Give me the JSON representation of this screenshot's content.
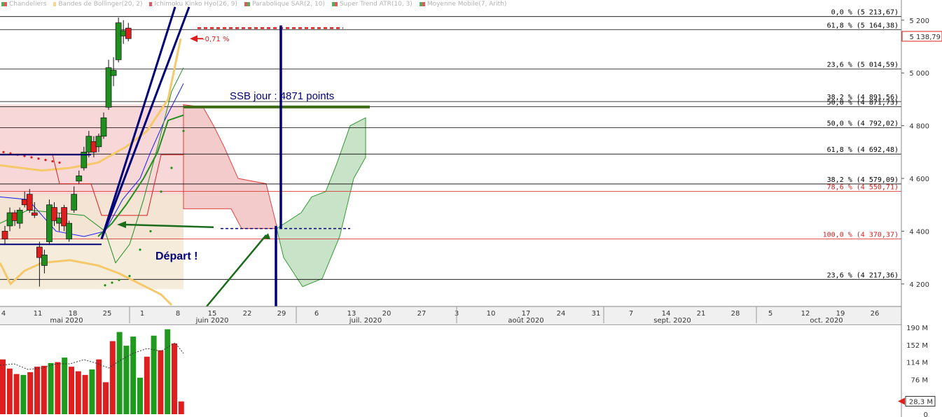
{
  "legend": [
    {
      "label": "Chandeliers",
      "colors": [
        "#1f8f1f",
        "#dd1f1f"
      ]
    },
    {
      "label": "Bandes de Bollinger(20, 2)",
      "colors": [
        "#f5c96b"
      ]
    },
    {
      "label": "Ichimoku Kinko Hyo(26, 9)",
      "colors": [
        "#dd1f1f"
      ]
    },
    {
      "label": "Parabolique SAR(2, 10)",
      "colors": [
        "#dd1f1f",
        "#1f8f1f"
      ]
    },
    {
      "label": "Super Trend ATR(10, 3)",
      "colors": [
        "#1f8f1f",
        "#dd1f1f"
      ]
    },
    {
      "label": "Moyenne Mobile(7, Arith)",
      "colors": [
        "#1f8f1f",
        "#dd1f1f"
      ]
    }
  ],
  "chart_data": [
    {
      "type": "candlestick",
      "title": "",
      "price_axis": {
        "ticks": [
          "5 200",
          "5 000",
          "4 800",
          "4 600",
          "4 400",
          "4 200"
        ],
        "ylim": [
          4120,
          5250
        ]
      },
      "last_price_label": "5 138,79",
      "x_axis": {
        "day_ticks": [
          "4",
          "11",
          "18",
          "25",
          "1",
          "8",
          "15",
          "22",
          "29",
          "6",
          "13",
          "20",
          "27",
          "3",
          "10",
          "17",
          "24",
          "31",
          "7",
          "14",
          "21",
          "28",
          "5",
          "12",
          "19",
          "26"
        ],
        "month_labels": [
          "mai 2020",
          "juin 2020",
          "juil. 2020",
          "août 2020",
          "sept. 2020",
          "oct. 2020"
        ]
      },
      "candles": [
        {
          "o": 4400,
          "h": 4420,
          "l": 4350,
          "c": 4370
        },
        {
          "o": 4420,
          "h": 4490,
          "l": 4400,
          "c": 4470
        },
        {
          "o": 4470,
          "h": 4480,
          "l": 4420,
          "c": 4440
        },
        {
          "o": 4430,
          "h": 4490,
          "l": 4410,
          "c": 4480
        },
        {
          "o": 4520,
          "h": 4550,
          "l": 4490,
          "c": 4500
        },
        {
          "o": 4540,
          "h": 4560,
          "l": 4470,
          "c": 4480
        },
        {
          "o": 4470,
          "h": 4510,
          "l": 4450,
          "c": 4460
        },
        {
          "o": 4340,
          "h": 4360,
          "l": 4190,
          "c": 4300
        },
        {
          "o": 4270,
          "h": 4330,
          "l": 4240,
          "c": 4310
        },
        {
          "o": 4360,
          "h": 4520,
          "l": 4350,
          "c": 4500
        },
        {
          "o": 4490,
          "h": 4510,
          "l": 4420,
          "c": 4440
        },
        {
          "o": 4430,
          "h": 4470,
          "l": 4400,
          "c": 4450
        },
        {
          "o": 4490,
          "h": 4500,
          "l": 4400,
          "c": 4420
        },
        {
          "o": 4370,
          "h": 4440,
          "l": 4360,
          "c": 4430
        },
        {
          "o": 4480,
          "h": 4570,
          "l": 4470,
          "c": 4540
        },
        {
          "o": 4590,
          "h": 4630,
          "l": 4580,
          "c": 4610
        },
        {
          "o": 4640,
          "h": 4720,
          "l": 4630,
          "c": 4700
        },
        {
          "o": 4700,
          "h": 4780,
          "l": 4680,
          "c": 4760
        },
        {
          "o": 4740,
          "h": 4760,
          "l": 4680,
          "c": 4700
        },
        {
          "o": 4720,
          "h": 4770,
          "l": 4700,
          "c": 4760
        },
        {
          "o": 4760,
          "h": 4850,
          "l": 4750,
          "c": 4830
        },
        {
          "o": 4870,
          "h": 5050,
          "l": 4860,
          "c": 5020
        },
        {
          "o": 4990,
          "h": 5060,
          "l": 4950,
          "c": 5010
        },
        {
          "o": 5050,
          "h": 5210,
          "l": 5040,
          "c": 5190
        },
        {
          "o": 5140,
          "h": 5200,
          "l": 5110,
          "c": 5160
        },
        {
          "o": 5170,
          "h": 5190,
          "l": 5120,
          "c": 5130
        }
      ],
      "fibonacci_levels": [
        {
          "label": "0,0 % (5 213,67)",
          "value": 5213.67,
          "color": "#000000"
        },
        {
          "label": "61,8 % (5 164,38)",
          "value": 5164.38,
          "color": "#000000"
        },
        {
          "label": "23,6 % (5 014,59)",
          "value": 5014.59,
          "color": "#000000"
        },
        {
          "label": "38,2 % (4 891,56)",
          "value": 4891.56,
          "color": "#000000"
        },
        {
          "label": "50,0 % (4 871,73)",
          "value": 4871.73,
          "color": "#000000"
        },
        {
          "label": "50,0 % (4 792,02)",
          "value": 4792.02,
          "color": "#000000"
        },
        {
          "label": "61,8 % (4 692,48)",
          "value": 4692.48,
          "color": "#000000"
        },
        {
          "label": "38,2 % (4 579,09)",
          "value": 4579.09,
          "color": "#000000"
        },
        {
          "label": "78,6 % (4 550,71)",
          "value": 4550.71,
          "color": "#dd1f1f"
        },
        {
          "label": "100,0 % (4 370,37)",
          "value": 4370.37,
          "color": "#dd1f1f"
        },
        {
          "label": "23,6 % (4 217,36)",
          "value": 4217.36,
          "color": "#000000"
        }
      ],
      "annotations": {
        "variation": "-0,71 %",
        "ssb_text": "SSB jour : 4871 points",
        "depart_text": "Départ !"
      }
    },
    {
      "type": "bar",
      "title": "",
      "volume_axis": {
        "ticks": [
          "190 M",
          "152 M",
          "114 M",
          "76 M",
          "0"
        ],
        "ylim": [
          0,
          190
        ]
      },
      "last_volume_label": "28,3 M",
      "volumes": [
        {
          "v": 120,
          "up": false
        },
        {
          "v": 100,
          "up": false
        },
        {
          "v": 88,
          "up": false
        },
        {
          "v": 86,
          "up": true
        },
        {
          "v": 92,
          "up": false
        },
        {
          "v": 104,
          "up": false
        },
        {
          "v": 106,
          "up": false
        },
        {
          "v": 112,
          "up": true
        },
        {
          "v": 114,
          "up": false
        },
        {
          "v": 124,
          "up": true
        },
        {
          "v": 104,
          "up": false
        },
        {
          "v": 94,
          "up": false
        },
        {
          "v": 86,
          "up": false
        },
        {
          "v": 98,
          "up": true
        },
        {
          "v": 120,
          "up": false
        },
        {
          "v": 70,
          "up": false
        },
        {
          "v": 160,
          "up": false
        },
        {
          "v": 180,
          "up": true
        },
        {
          "v": 150,
          "up": true
        },
        {
          "v": 170,
          "up": true
        },
        {
          "v": 80,
          "up": true
        },
        {
          "v": 126,
          "up": false
        },
        {
          "v": 172,
          "up": true
        },
        {
          "v": 140,
          "up": false
        },
        {
          "v": 186,
          "up": true
        },
        {
          "v": 155,
          "up": false
        },
        {
          "v": 28,
          "up": false
        }
      ]
    }
  ]
}
